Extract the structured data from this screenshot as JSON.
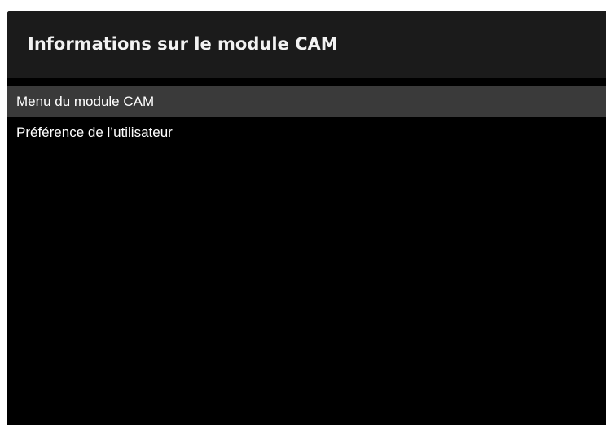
{
  "window": {
    "title": "Informations sur le module CAM"
  },
  "menu": {
    "selected_index": 0,
    "items": [
      {
        "label": "Menu du module CAM"
      },
      {
        "label": "Préférence de l’utilisateur"
      }
    ]
  },
  "colors": {
    "background": "#000000",
    "header": "#1b1b1b",
    "selection": "#3a3a3a",
    "text": "#ffffff"
  }
}
